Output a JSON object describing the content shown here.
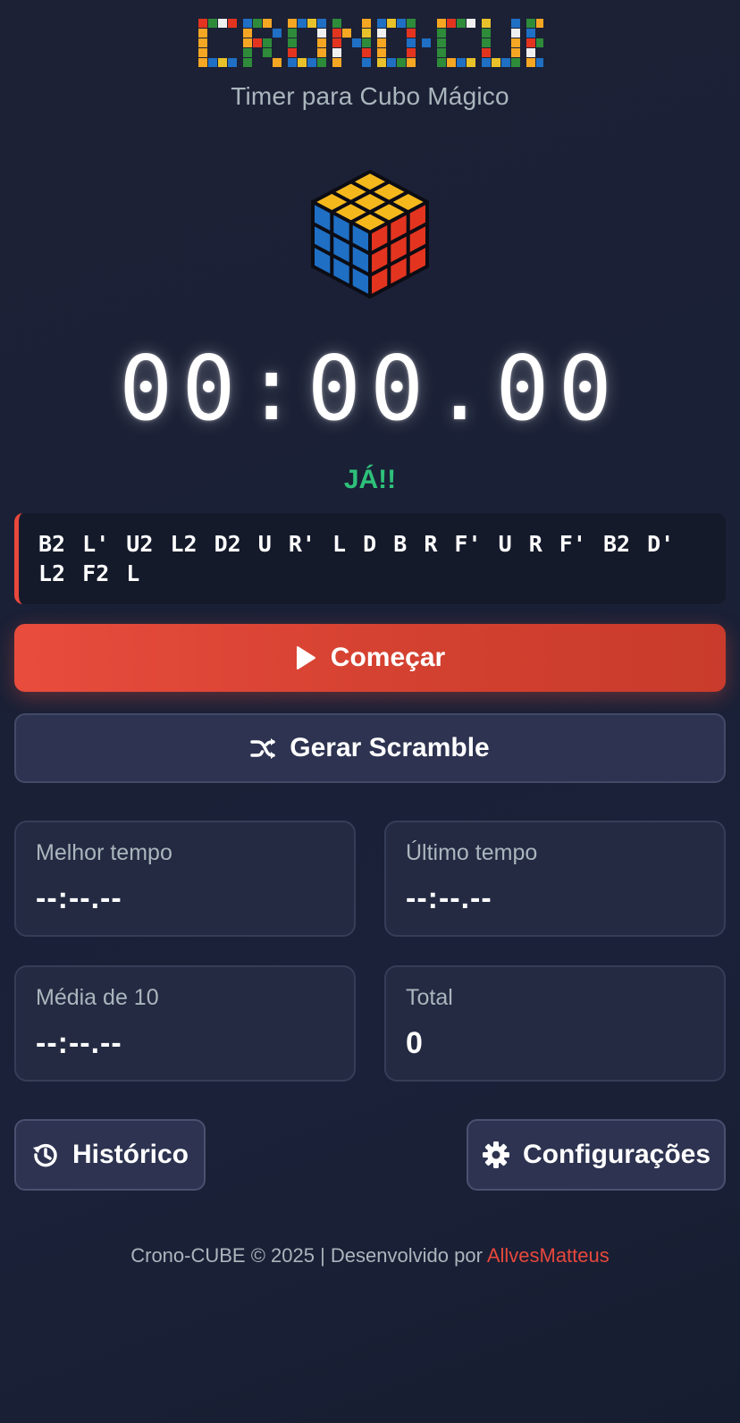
{
  "app": {
    "logo_text": "CRONO-CUBE",
    "subtitle": "Timer para Cubo Mágico"
  },
  "cube": {
    "icon": "rubiks-cube-icon"
  },
  "timer": {
    "display": "00:00.00",
    "status": "JÁ!!"
  },
  "scramble": {
    "text": "B2 L' U2 L2 D2 U R' L D B R F' U R F' B2 D' L2 F2 L"
  },
  "actions": {
    "start_label": "Começar",
    "start_icon": "play-icon",
    "generate_label": "Gerar Scramble",
    "generate_icon": "shuffle-icon"
  },
  "stats": [
    {
      "label": "Melhor tempo",
      "value": "--:--.--"
    },
    {
      "label": "Último tempo",
      "value": "--:--.--"
    },
    {
      "label": "Média de 10",
      "value": "--:--.--"
    },
    {
      "label": "Total",
      "value": "0"
    }
  ],
  "nav": {
    "history_label": "Histórico",
    "history_icon": "history-icon",
    "settings_label": "Configurações",
    "settings_icon": "gear-icon"
  },
  "footer": {
    "text": "Crono-CUBE © 2025 | Desenvolvido por ",
    "author": "AllvesMatteus"
  },
  "colors": {
    "accent": "#e84c3d",
    "status_green": "#2ec07a",
    "cube_yellow": "#f5b81c",
    "cube_blue": "#1f6fc4",
    "cube_red": "#e3341f"
  }
}
